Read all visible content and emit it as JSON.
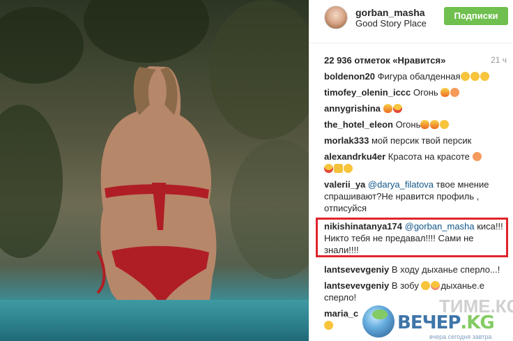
{
  "header": {
    "username": "gorban_masha",
    "location": "Good Story Place",
    "follow_label": "Подписки"
  },
  "stats": {
    "likes": "22 936 отметок «Нравится»",
    "time": "21 ч"
  },
  "comments": [
    {
      "user": "boldenon20",
      "text": "Фигура обалденная",
      "emojis": [
        "ok-hand-icon",
        "ok-hand-icon",
        "ok-hand-icon"
      ]
    },
    {
      "user": "timofey_olenin_iccc",
      "text": "Огонь",
      "emojis": [
        "fire-icon",
        "peach-icon"
      ]
    },
    {
      "user": "annygrishina",
      "text": "",
      "emojis": [
        "fire-icon",
        "heart-eyes-icon"
      ]
    },
    {
      "user": "the_hotel_eleon",
      "text": "Огонь",
      "emojis": [
        "fire-icon",
        "fire-icon",
        "grin-icon"
      ]
    },
    {
      "user": "morlak333",
      "text": "мой персик твой персик",
      "emojis": []
    },
    {
      "user": "alexandrku4er",
      "text": "Красота на красоте",
      "emojis": [
        "peach-icon",
        "heart-eyes-icon",
        "thumbs-up-icon",
        "smile-icon"
      ]
    },
    {
      "user": "valerii_ya",
      "mention": "@darya_filatova",
      "text": "твое мнение спрашивают?Не нравится профиль , отписуйся",
      "emojis": []
    },
    {
      "user": "nikishinatanya174",
      "mention": "@gorban_masha",
      "text": "киса!!! Никто тебя не предавал!!!! Сами не знали!!!!",
      "emojis": []
    },
    {
      "user": "lantsevevgeniy",
      "text": "В ходу дыханье сперло...!",
      "emojis": []
    },
    {
      "user": "lantsevevgeniy",
      "text": "В зобу",
      "text2": "дыханье.е сперло!",
      "emojis": [
        "smile-icon",
        "kiss-icon"
      ]
    },
    {
      "user": "maria_c",
      "text": "",
      "emojis": [
        "smile-icon"
      ]
    }
  ],
  "watermark": {
    "title_main": "ВЕЧЕР",
    "title_accent": ".KG",
    "tagline": "вчера сегодня завтра",
    "ghost": "ТИМЕ.КG"
  },
  "colors": {
    "follow_bg": "#70c050",
    "highlight_border": "#e0242c",
    "mention": "#125688"
  }
}
